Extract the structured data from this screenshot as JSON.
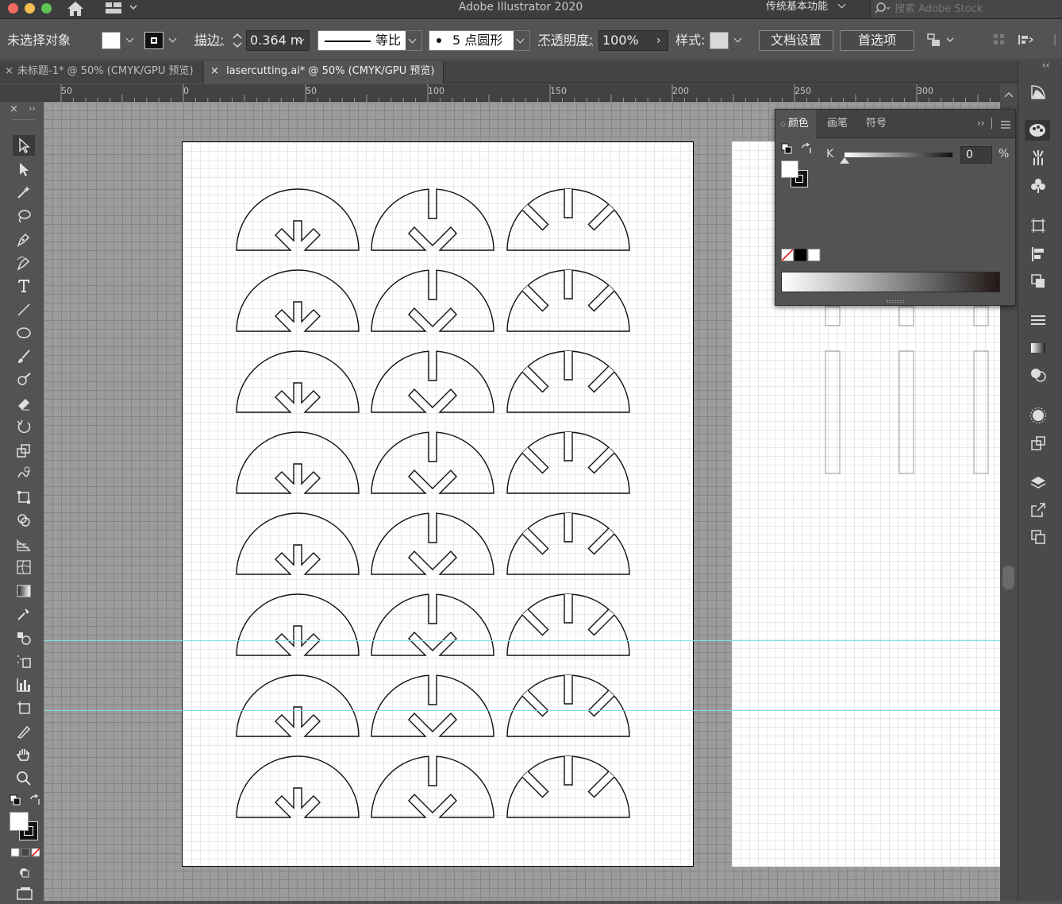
{
  "window": {
    "title": "Adobe Illustrator 2020"
  },
  "titlebar": {
    "workspace": "传统基本功能",
    "search_placeholder": "搜索 Adobe Stock"
  },
  "control_bar": {
    "selection_status": "未选择对象",
    "stroke_label": "描边:",
    "stroke_value": "0.364 m",
    "profile_label": "等比",
    "brush_label": "5 点圆形",
    "opacity_label": "不透明度:",
    "opacity_value": "100%",
    "style_label": "样式:",
    "doc_setup_button": "文档设置",
    "preferences_button": "首选项"
  },
  "tabs": [
    {
      "label": "未标题-1* @ 50% (CMYK/GPU 预览)",
      "active": false
    },
    {
      "label": "lasercutting.ai* @ 50% (CMYK/GPU 预览)",
      "active": true
    }
  ],
  "ruler": {
    "labels": [
      "50",
      "0",
      "50",
      "100",
      "150",
      "200",
      "250",
      "300"
    ]
  },
  "color_panel": {
    "tabs": [
      "颜色",
      "画笔",
      "符号"
    ],
    "channel": "K",
    "value": "0",
    "unit": "%"
  },
  "colors": {
    "accent": "#7ee0e8",
    "panel": "#535353",
    "dark": "#3d3d3d"
  },
  "artwork": {
    "rows": 8,
    "columns": 3,
    "shape_types": [
      "arrow",
      "v-slot",
      "three-slot"
    ]
  }
}
